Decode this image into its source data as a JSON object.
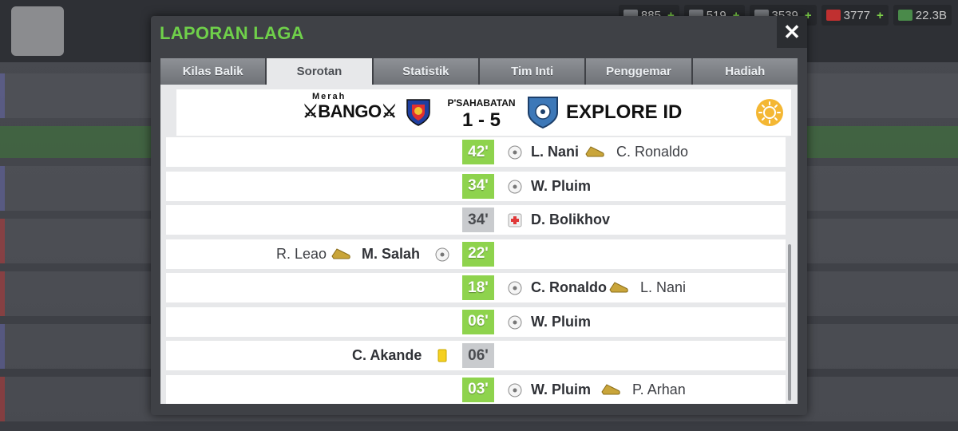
{
  "background": {
    "resources": [
      {
        "value": "885"
      },
      {
        "value": "519"
      },
      {
        "value": "3539"
      },
      {
        "value": "3777"
      },
      {
        "value": "22.3B"
      }
    ]
  },
  "dialog": {
    "title": "LAPORAN LAGA",
    "close_symbol": "✕"
  },
  "tabs": [
    {
      "label": "Kilas Balik",
      "active": false
    },
    {
      "label": "Sorotan",
      "active": true
    },
    {
      "label": "Statistik",
      "active": false
    },
    {
      "label": "Tim Inti",
      "active": false
    },
    {
      "label": "Penggemar",
      "active": false
    },
    {
      "label": "Hadiah",
      "active": false
    }
  ],
  "match": {
    "home_team_top": "Merah",
    "home_team": "⚔BANGO⚔",
    "match_type": "P'SAHABATAN",
    "score": "1 - 5",
    "away_team": "EXPLORE ID",
    "weather_icon": "sun-icon"
  },
  "events": [
    {
      "minute": "42'",
      "side": "away",
      "type": "goal",
      "player": "L. Nani",
      "assist": "C. Ronaldo",
      "minute_color": "green"
    },
    {
      "minute": "34'",
      "side": "away",
      "type": "goal",
      "player": "W. Pluim",
      "assist": "",
      "minute_color": "green"
    },
    {
      "minute": "34'",
      "side": "away",
      "type": "injury",
      "player": "D. Bolikhov",
      "assist": "",
      "minute_color": "grey"
    },
    {
      "minute": "22'",
      "side": "home",
      "type": "goal",
      "player": "M. Salah",
      "assist": "R. Leao",
      "minute_color": "green"
    },
    {
      "minute": "18'",
      "side": "away",
      "type": "goal",
      "player": "C. Ronaldo",
      "assist": "L. Nani",
      "minute_color": "green"
    },
    {
      "minute": "06'",
      "side": "away",
      "type": "goal",
      "player": "W. Pluim",
      "assist": "",
      "minute_color": "green"
    },
    {
      "minute": "06'",
      "side": "home",
      "type": "yellow-card",
      "player": "C. Akande",
      "assist": "",
      "minute_color": "grey"
    },
    {
      "minute": "03'",
      "side": "away",
      "type": "goal",
      "player": "W. Pluim",
      "assist": "P. Arhan",
      "minute_color": "green"
    }
  ]
}
